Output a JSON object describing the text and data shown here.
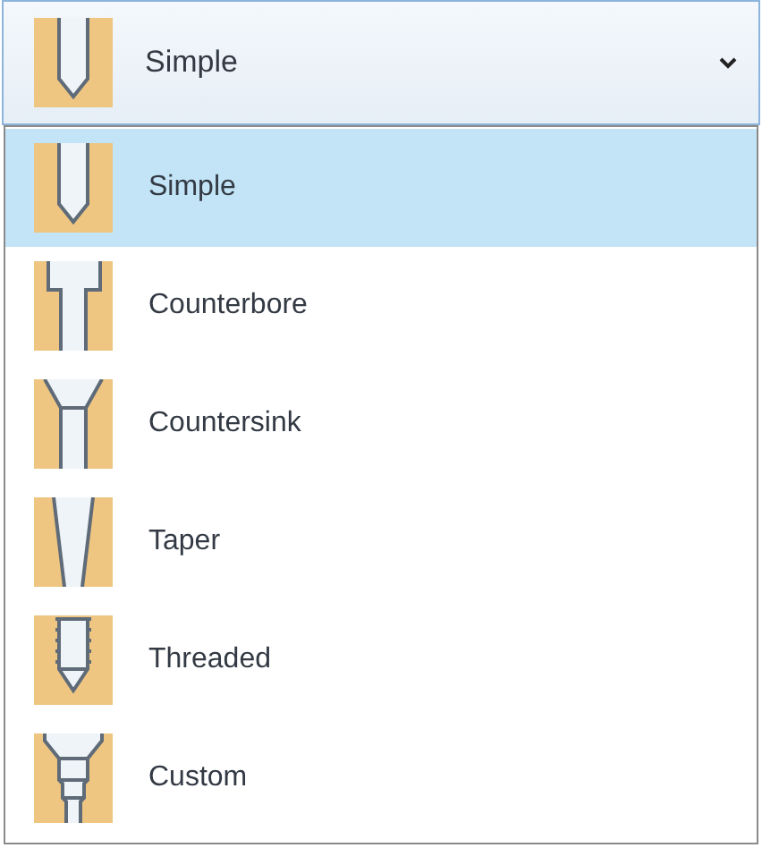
{
  "combo": {
    "kind": "simple",
    "value": "Simple",
    "expanded": true
  },
  "options": [
    {
      "kind": "simple",
      "label": "Simple",
      "selected": true
    },
    {
      "kind": "counterbore",
      "label": "Counterbore",
      "selected": false
    },
    {
      "kind": "countersink",
      "label": "Countersink",
      "selected": false
    },
    {
      "kind": "taper",
      "label": "Taper",
      "selected": false
    },
    {
      "kind": "threaded",
      "label": "Threaded",
      "selected": false
    },
    {
      "kind": "custom",
      "label": "Custom",
      "selected": false
    }
  ]
}
